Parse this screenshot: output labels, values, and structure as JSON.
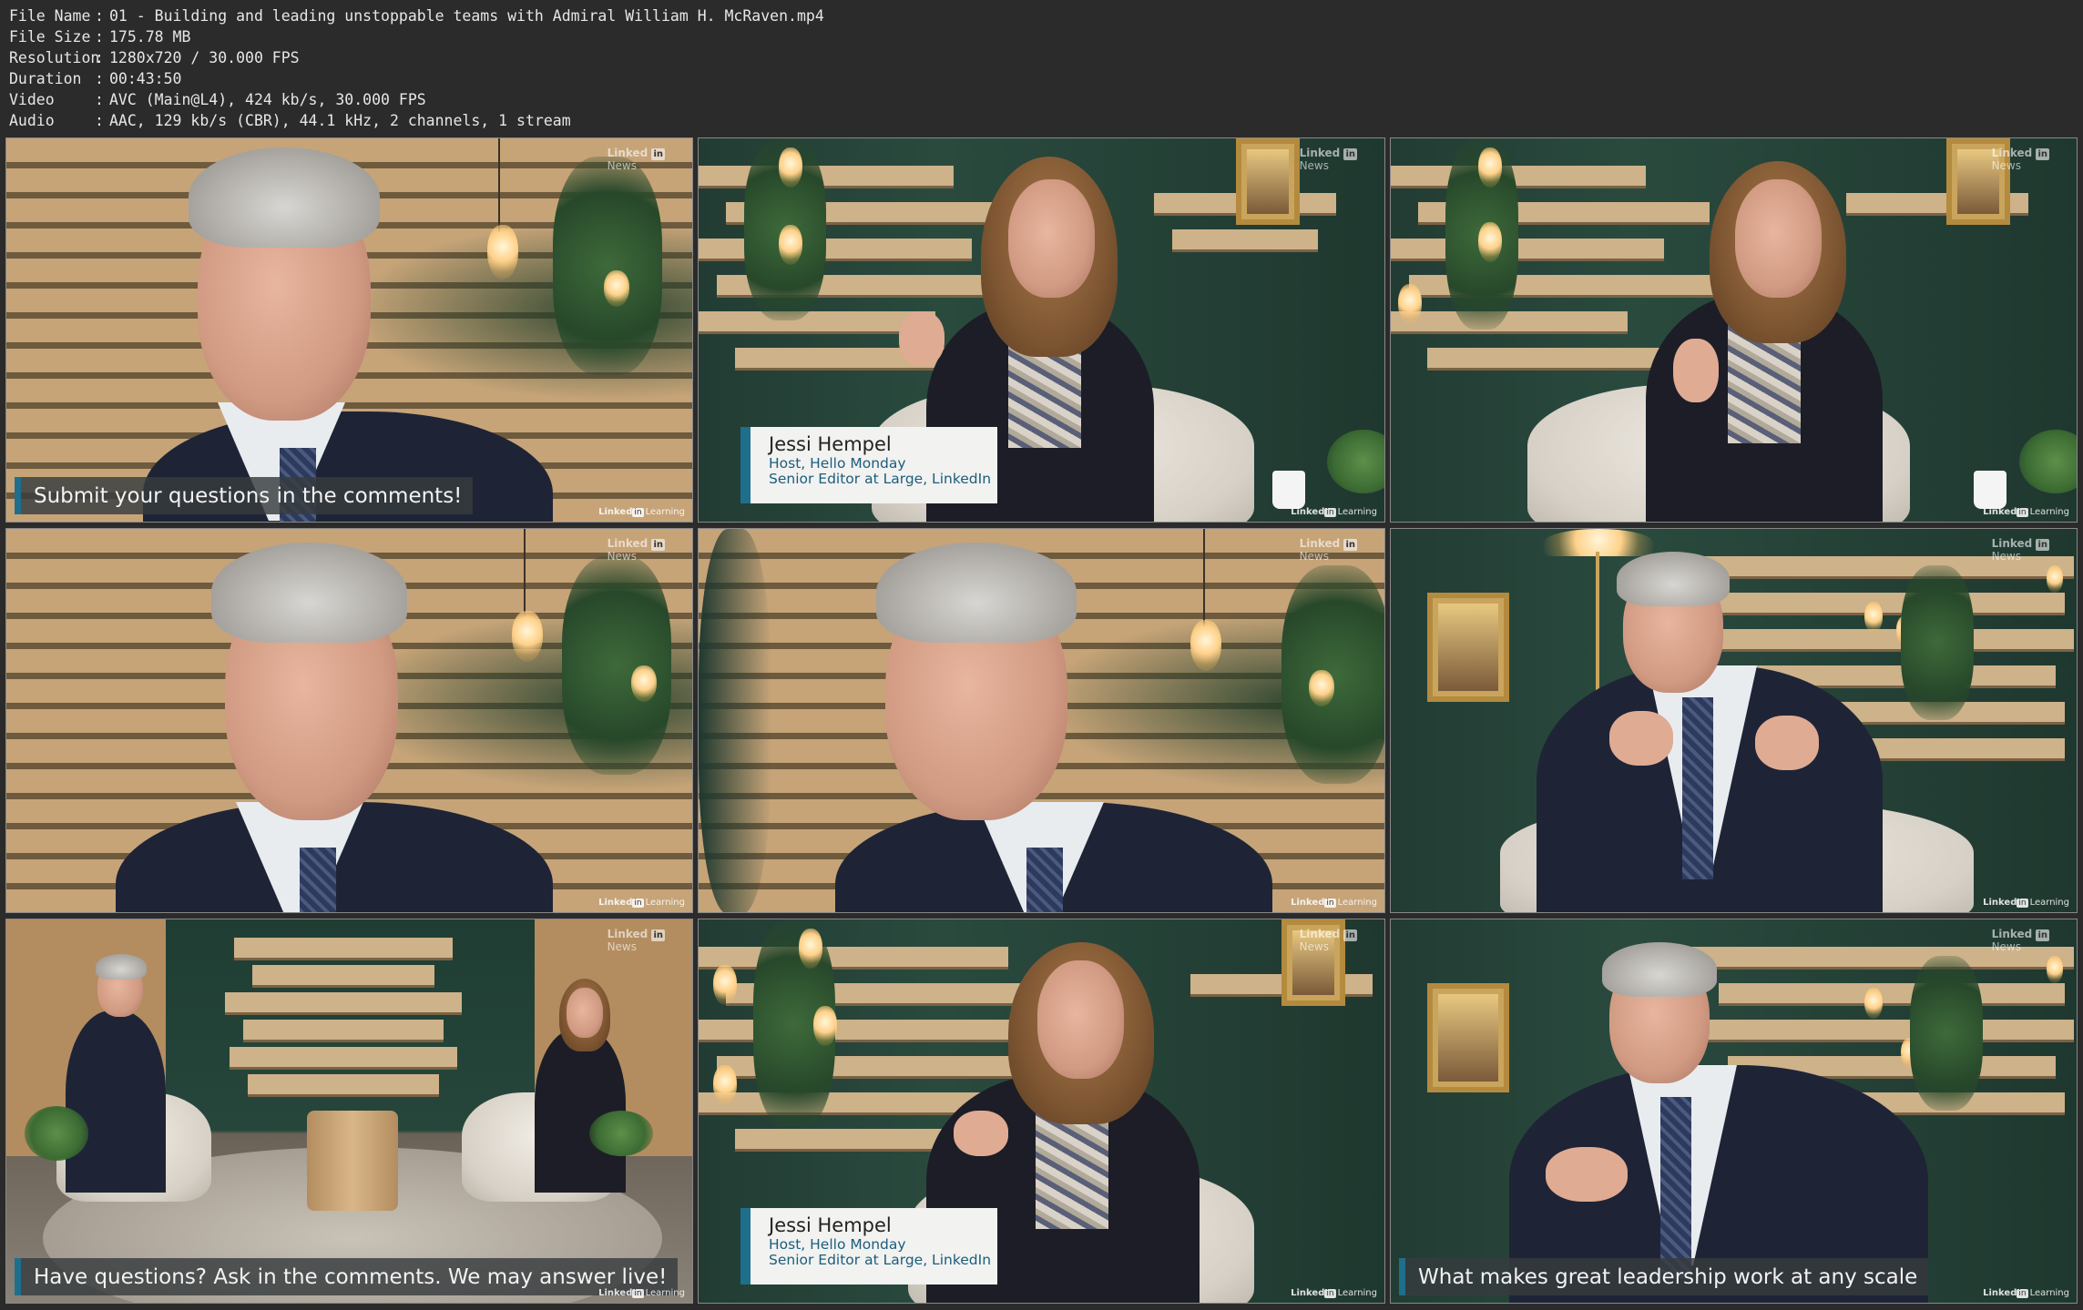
{
  "info": {
    "rows": [
      {
        "key": "File Name",
        "value": "01 - Building and leading unstoppable teams with Admiral William H. McRaven.mp4"
      },
      {
        "key": "File Size",
        "value": "175.78 MB"
      },
      {
        "key": "Resolution",
        "value": "1280x720 / 30.000 FPS"
      },
      {
        "key": "Duration",
        "value": "00:43:50"
      },
      {
        "key": "Video",
        "value": "AVC (Main@L4), 424 kb/s, 30.000 FPS"
      },
      {
        "key": "Audio",
        "value": "AAC, 129 kb/s (CBR), 44.1 kHz, 2 channels, 1 stream"
      }
    ],
    "separator": ":"
  },
  "branding": {
    "top_line1": "Linked",
    "top_in": "in",
    "top_line2": "News",
    "bottom_brand": "Linked",
    "bottom_in": "in",
    "bottom_product": "Learning"
  },
  "frames": {
    "f1": {
      "caption": "Submit your questions in the comments!"
    },
    "f2": {
      "name": "Jessi Hempel",
      "role1": "Host, Hello Monday",
      "role2": "Senior Editor at Large, LinkedIn"
    },
    "f7": {
      "caption": "Have questions? Ask in the comments. We may answer live!"
    },
    "f8": {
      "name": "Jessi Hempel",
      "role1": "Host, Hello Monday",
      "role2": "Senior Editor at Large, LinkedIn"
    },
    "f9": {
      "caption": "What makes great leadership work at any scale"
    }
  },
  "colors": {
    "background": "#2b2b2b",
    "accent": "#1e6f8c"
  }
}
